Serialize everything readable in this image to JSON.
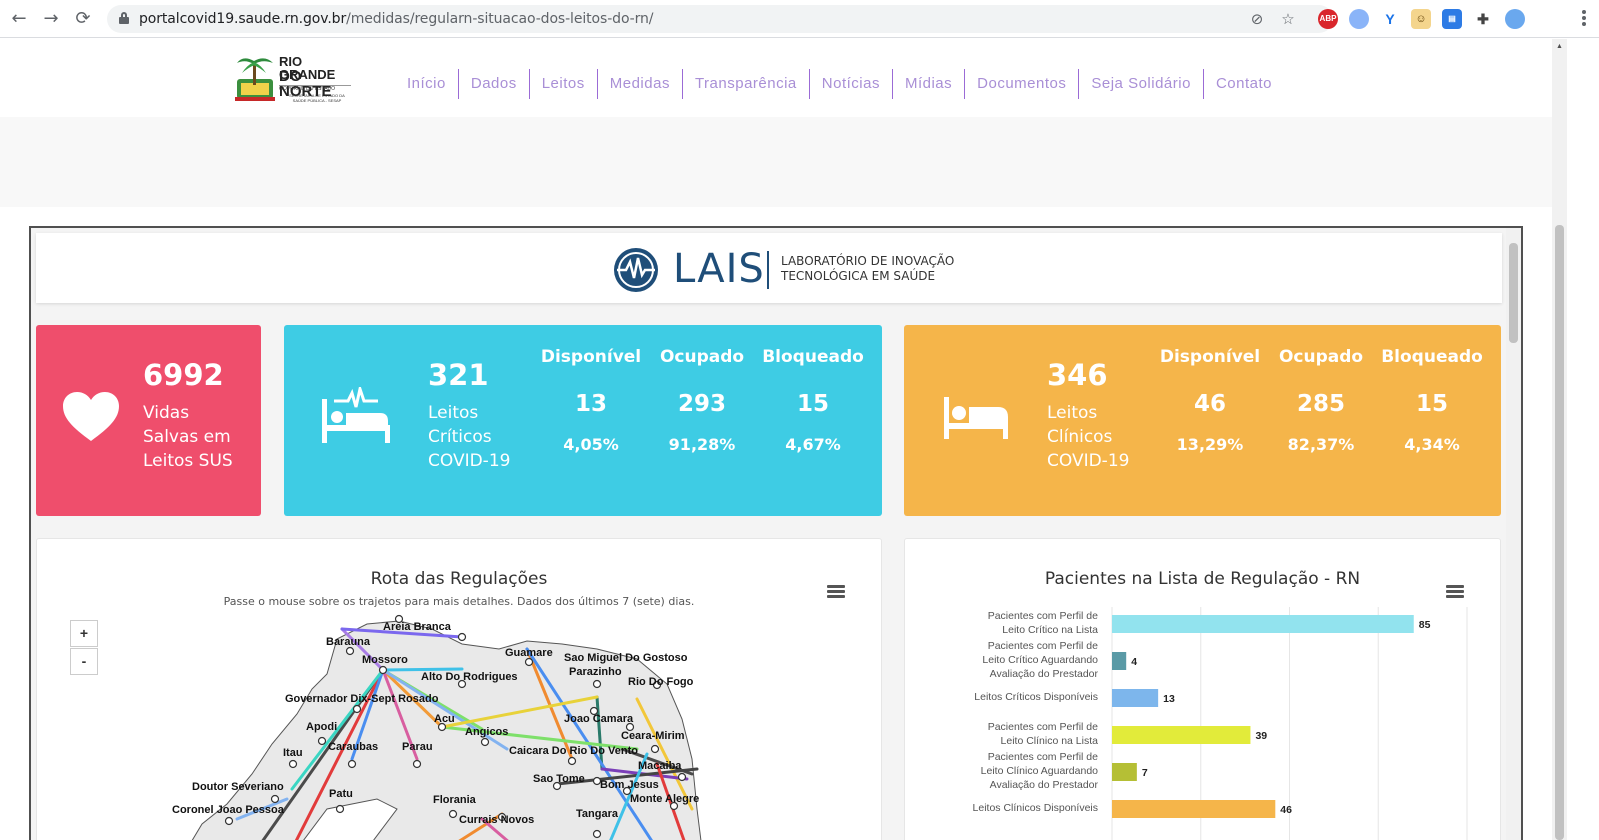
{
  "browser": {
    "url_host": "portalcovid19.saude.rn.gov.br",
    "url_path": "/medidas/regularn-situacao-dos-leitos-do-rn/",
    "extensions": [
      "ABP"
    ]
  },
  "site": {
    "logo": {
      "line1": "RIO GRANDE",
      "line2": "DO NORTE",
      "line3": "GOVERNO DO ESTADO",
      "line4": "SECRETARIA DE ESTADO DA SAÚDE PÚBLICA - SESAP"
    },
    "menu": [
      "Início",
      "Dados",
      "Leitos",
      "Medidas",
      "Transparência",
      "Notícias",
      "Mídias",
      "Documentos",
      "Seja Solidário",
      "Contato"
    ]
  },
  "lais": {
    "word": "LAIS",
    "subtitle_line1": "LABORATÓRIO DE INOVAÇÃO",
    "subtitle_line2": "TECNOLÓGICA EM SAÚDE"
  },
  "cards": {
    "lives": {
      "value": "6992",
      "label_l1": "Vidas",
      "label_l2": "Salvas em",
      "label_l3": "Leitos SUS",
      "color": "#ef4e6c"
    },
    "critical": {
      "value": "321",
      "label_l1": "Leitos",
      "label_l2": "Críticos",
      "label_l3": "COVID-19",
      "color": "#3ecce4",
      "columns": [
        {
          "header": "Disponível",
          "value": "13",
          "percent": "4,05%"
        },
        {
          "header": "Ocupado",
          "value": "293",
          "percent": "91,28%"
        },
        {
          "header": "Bloqueado",
          "value": "15",
          "percent": "4,67%"
        }
      ]
    },
    "clinical": {
      "value": "346",
      "label_l1": "Leitos",
      "label_l2": "Clínicos",
      "label_l3": "COVID-19",
      "color": "#f5b54a",
      "columns": [
        {
          "header": "Disponível",
          "value": "46",
          "percent": "13,29%"
        },
        {
          "header": "Ocupado",
          "value": "285",
          "percent": "82,37%"
        },
        {
          "header": "Bloqueado",
          "value": "15",
          "percent": "4,34%"
        }
      ]
    }
  },
  "map_panel": {
    "title": "Rota das Regulações",
    "subtitle": "Passe o mouse sobre os trajetos para mais detalhes. Dados dos últimos 7 (sete) dias.",
    "zoom_in": "+",
    "zoom_out": "-",
    "cities": [
      "Areia Branca",
      "Barauna",
      "Mossoro",
      "Guamare",
      "Sao Miguel Do Gostoso",
      "Parazinho",
      "Rio Do Fogo",
      "Alto Do Rodrigues",
      "Governador Dix-Sept Rosado",
      "Joao Camara",
      "Acu",
      "Apodi",
      "Angicos",
      "Ceara-Mirim",
      "Itau",
      "Caraubas",
      "Parau",
      "Caicara Do Rio Do Vento",
      "Macaiba",
      "Sao Tome",
      "Doutor Severiano",
      "Bom Jesus",
      "Patu",
      "Monte Alegre",
      "Florania",
      "Coronel Joao Pessoa",
      "Currais Novos",
      "Tangara"
    ]
  },
  "chart_data": {
    "type": "bar",
    "orientation": "horizontal",
    "title": "Pacientes na Lista de Regulação - RN",
    "categories": [
      "Pacientes com Perfil de Leito Crítico na Lista",
      "Pacientes com Perfil de Leito Crítico Aguardando Avaliação do Prestador",
      "Leitos Críticos Disponíveis",
      "Pacientes com Perfil de Leito Clínico na Lista",
      "Pacientes com Perfil de Leito Clínico Aguardando Avaliação do Prestador",
      "Leitos Clínicos Disponíveis"
    ],
    "values": [
      85,
      4,
      13,
      39,
      7,
      46
    ],
    "colors": [
      "#92e3ee",
      "#5a9aa6",
      "#7db6ec",
      "#e2eb3a",
      "#b5bf35",
      "#f5b54a"
    ],
    "xlim": [
      0,
      100
    ],
    "grid": true
  }
}
